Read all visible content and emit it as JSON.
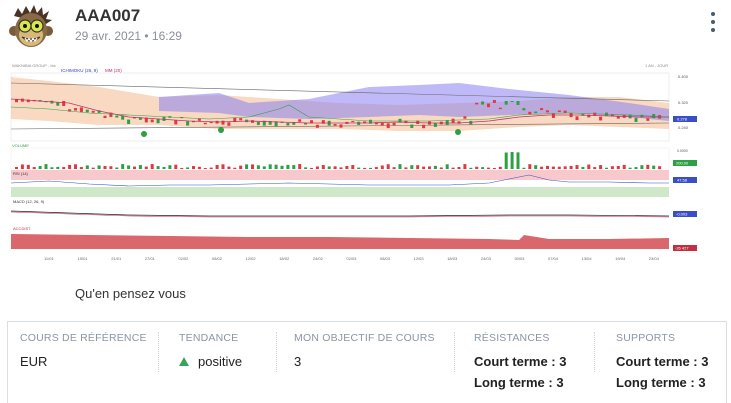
{
  "post": {
    "author": "AAA007",
    "date": "29 avr. 2021 • 16:29",
    "caption": "Qu'en pensez vous"
  },
  "chart_labels": {
    "header": "WAKNIBIA GROUP - bis",
    "ichimoku": "ICHIMOKU (26, 9)",
    "mm": "MM (20)",
    "period": "1 AN - JOUR",
    "volume": "VOLUME",
    "rsi": "RSI (14)",
    "macd": "MACD (12, 26, 9)",
    "accdist": "ACCDIST",
    "price_ticks": [
      "0.400",
      "0.320",
      "0.270",
      "0.240"
    ],
    "current_price": "0.278",
    "volume_ticks": [
      "0.0000",
      "0.0000"
    ],
    "volume_value": "200.00",
    "rsi_value": "47.58",
    "rsi_ticks": [
      "80",
      "20"
    ],
    "macd_value": "-0.003",
    "macd_ticks": [
      "0.000",
      "0.000"
    ],
    "accdist_value": "-26 427",
    "x_ticks": [
      "11/01",
      "15/01",
      "21/01",
      "27/01",
      "02/02",
      "08/02",
      "12/02",
      "18/02",
      "24/02",
      "02/03",
      "08/03",
      "12/03",
      "18/03",
      "24/03",
      "30/03",
      "07/04",
      "13/04",
      "19/04",
      "23/04"
    ]
  },
  "panel": {
    "ref_head": "COURS DE RÉFÉRENCE",
    "ref_value": "EUR",
    "trend_head": "TENDANCE",
    "trend_value": "positive",
    "target_head": "MON OBJECTIF DE COURS",
    "target_value": "3",
    "res_head": "RÉSISTANCES",
    "res_short": "Court terme : 3",
    "res_long": "Long terme : 3",
    "sup_head": "SUPPORTS",
    "sup_short": "Court terme : 3",
    "sup_long": "Long terme : 3"
  },
  "colors": {
    "up": "#2ea043",
    "down": "#e0393e",
    "cloud": "#8a82f0",
    "band": "#f6c9a6",
    "accent": "#3aa35a"
  }
}
